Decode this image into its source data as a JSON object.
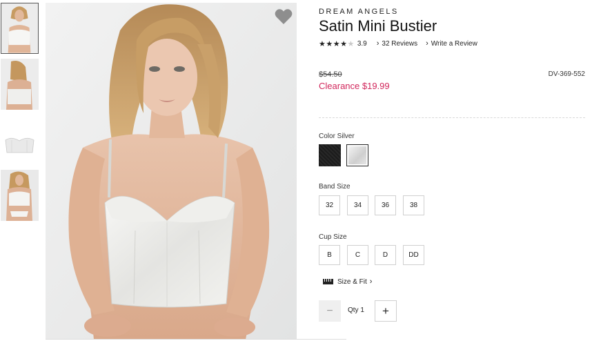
{
  "product": {
    "brand": "DREAM ANGELS",
    "title": "Satin Mini Bustier",
    "rating": "3.9",
    "stars_filled": 4,
    "stars_total": 5,
    "reviews_link": "32 Reviews",
    "write_review_link": "Write a Review",
    "old_price": "$54.50",
    "clearance_price": "Clearance $19.99",
    "sku": "DV-369-552"
  },
  "color": {
    "label": "Color Silver",
    "swatches": [
      {
        "name": "black",
        "hex": "#1c1c1c",
        "selected": false
      },
      {
        "name": "silver",
        "hex": "#dcdcdc",
        "selected": true
      }
    ]
  },
  "band_size": {
    "label": "Band Size",
    "options": [
      "32",
      "34",
      "36",
      "38"
    ]
  },
  "cup_size": {
    "label": "Cup Size",
    "options": [
      "B",
      "C",
      "D",
      "DD"
    ]
  },
  "size_fit": {
    "label": "Size & Fit",
    "icon": "ruler-icon"
  },
  "quantity": {
    "label": "Qty 1",
    "minus": "−",
    "plus": "+"
  },
  "icons": {
    "favorite": "heart-icon",
    "chevron": "chevron-right-icon"
  },
  "colors": {
    "accent": "#d1265b",
    "text": "#222222",
    "image_bg": "#eceded"
  }
}
